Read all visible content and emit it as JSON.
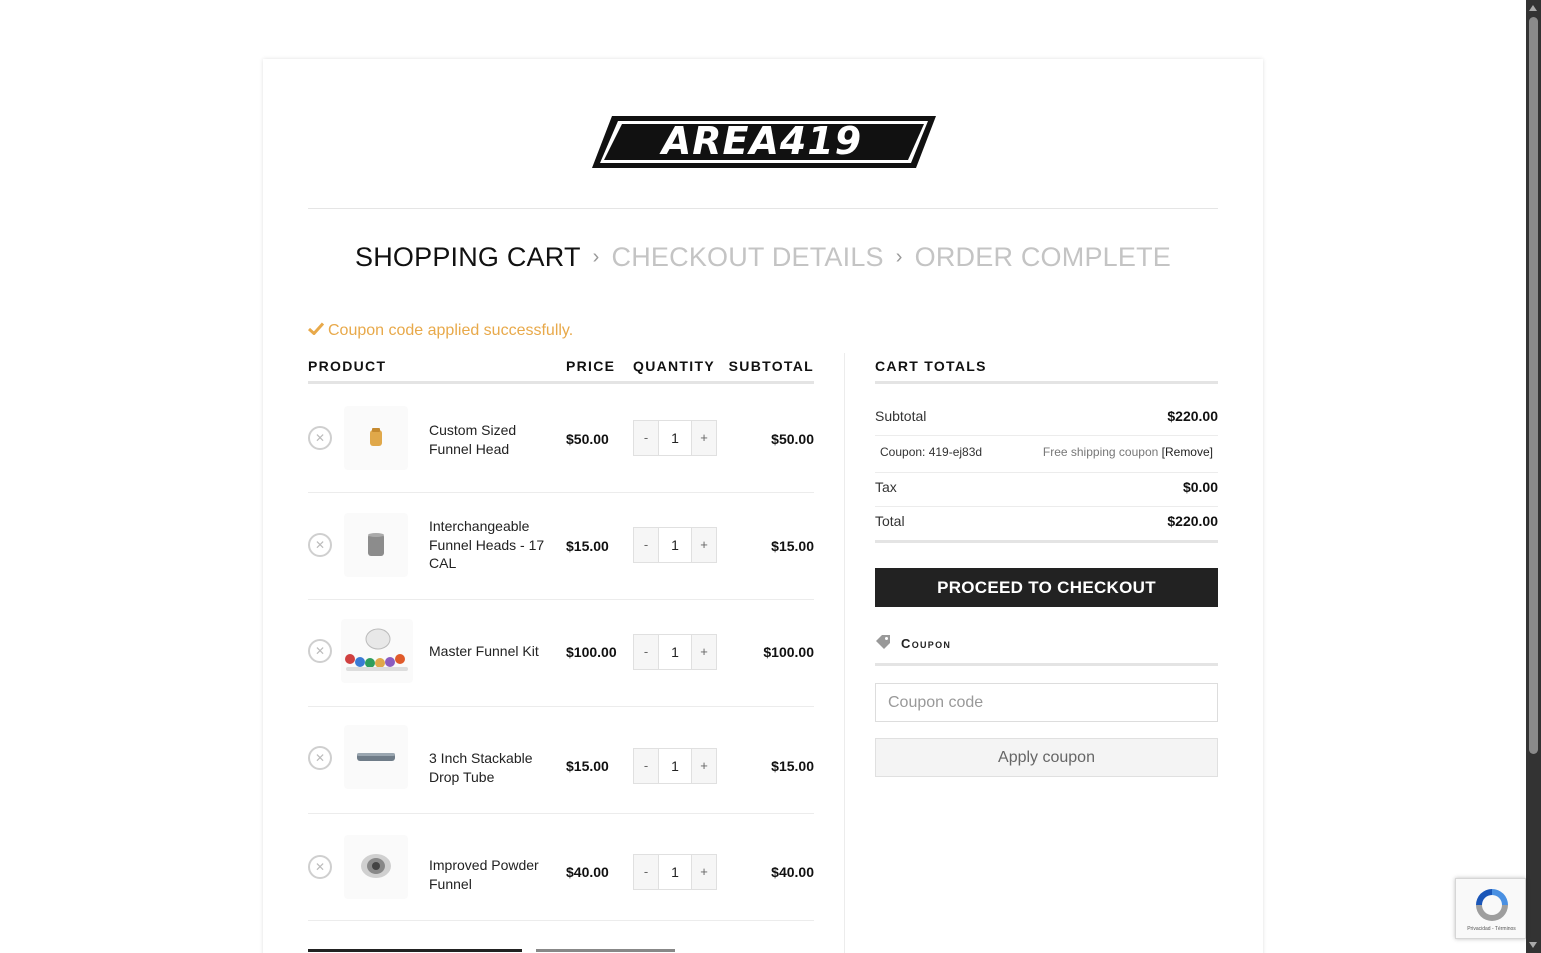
{
  "brand": {
    "logo_text": "AREA419"
  },
  "steps": {
    "step1": "SHOPPING CART",
    "step2": "CHECKOUT DETAILS",
    "step3": "ORDER COMPLETE",
    "separator": "›"
  },
  "notice": {
    "text": "Coupon code applied successfully.",
    "icon": "check-icon",
    "color": "#e8a94a"
  },
  "cart": {
    "headers": {
      "product": "PRODUCT",
      "price": "PRICE",
      "quantity": "QUANTITY",
      "subtotal": "SUBTOTAL"
    },
    "items": [
      {
        "name": "Custom Sized Funnel Head",
        "price": "$50.00",
        "qty": "1",
        "subtotal": "$50.00",
        "minus": "-",
        "plus": "+"
      },
      {
        "name": "Interchangeable Funnel Heads - 17 CAL",
        "price": "$15.00",
        "qty": "1",
        "subtotal": "$15.00",
        "minus": "-",
        "plus": "+"
      },
      {
        "name": "Master Funnel Kit",
        "price": "$100.00",
        "qty": "1",
        "subtotal": "$100.00",
        "minus": "-",
        "plus": "+"
      },
      {
        "name": "3 Inch Stackable Drop Tube",
        "price": "$15.00",
        "qty": "1",
        "subtotal": "$15.00",
        "minus": "-",
        "plus": "+"
      },
      {
        "name": "Improved Powder Funnel",
        "price": "$40.00",
        "qty": "1",
        "subtotal": "$40.00",
        "minus": "-",
        "plus": "+"
      }
    ]
  },
  "totals": {
    "title": "CART TOTALS",
    "subtotal_label": "Subtotal",
    "subtotal_value": "$220.00",
    "coupon_label": "Coupon: 419-ej83d",
    "coupon_value": "Free shipping coupon",
    "coupon_remove": "[Remove]",
    "tax_label": "Tax",
    "tax_value": "$0.00",
    "total_label": "Total",
    "total_value": "$220.00",
    "checkout_button": "PROCEED TO CHECKOUT"
  },
  "coupon": {
    "title": "Coupon",
    "placeholder": "Coupon code",
    "apply_button": "Apply coupon"
  },
  "recaptcha": {
    "text": "Privacidad - Términos"
  },
  "colors": {
    "accent": "#e8a94a",
    "dark": "#222222",
    "muted": "#c4c4c4"
  }
}
